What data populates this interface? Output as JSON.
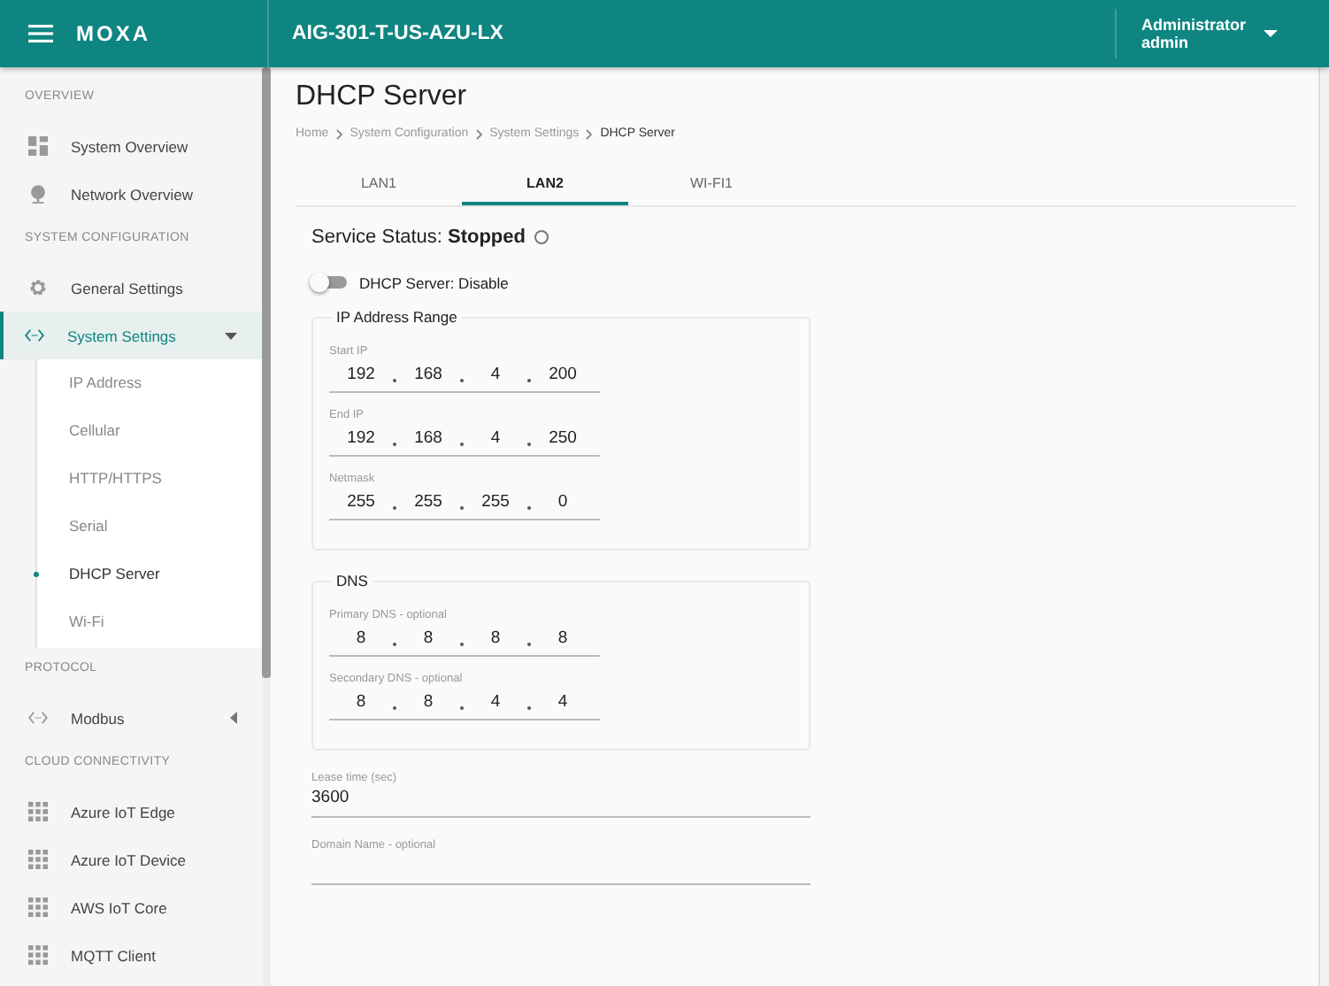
{
  "header": {
    "brand": "MOXA",
    "device": "AIG-301-T-US-AZU-LX",
    "user": {
      "role": "Administrator",
      "name": "admin"
    }
  },
  "sidebar": {
    "sections": [
      {
        "title": "OVERVIEW",
        "items": [
          {
            "label": "System Overview",
            "kind": "dashboard",
            "selected": false
          },
          {
            "label": "Network Overview",
            "kind": "globe",
            "selected": false
          }
        ]
      },
      {
        "title": "SYSTEM CONFIGURATION",
        "items": [
          {
            "label": "General Settings",
            "kind": "gear",
            "selected": false
          },
          {
            "label": "System Settings",
            "kind": "code",
            "selected": true,
            "expanded": true,
            "children": [
              {
                "label": "IP Address",
                "selected": false
              },
              {
                "label": "Cellular",
                "selected": false
              },
              {
                "label": "HTTP/HTTPS",
                "selected": false
              },
              {
                "label": "Serial",
                "selected": false
              },
              {
                "label": "DHCP Server",
                "selected": true
              },
              {
                "label": "Wi-Fi",
                "selected": false
              }
            ]
          }
        ]
      },
      {
        "title": "PROTOCOL",
        "items": [
          {
            "label": "Modbus",
            "kind": "code",
            "selected": false,
            "expanded": false
          }
        ]
      },
      {
        "title": "CLOUD CONNECTIVITY",
        "items": [
          {
            "label": "Azure IoT Edge",
            "kind": "apps",
            "selected": false
          },
          {
            "label": "Azure IoT Device",
            "kind": "apps",
            "selected": false
          },
          {
            "label": "AWS IoT Core",
            "kind": "apps",
            "selected": false
          },
          {
            "label": "MQTT Client",
            "kind": "apps",
            "selected": false
          }
        ]
      }
    ]
  },
  "page": {
    "title": "DHCP Server",
    "breadcrumb": [
      "Home",
      "System Configuration",
      "System Settings",
      "DHCP Server"
    ],
    "tabs": [
      {
        "label": "LAN1",
        "selected": false
      },
      {
        "label": "LAN2",
        "selected": true
      },
      {
        "label": "WI-FI1",
        "selected": false
      }
    ],
    "service_status": {
      "label": "Service Status:",
      "value": "Stopped",
      "running": false
    },
    "dhcp_toggle": {
      "label": "DHCP Server: Disable",
      "on": false
    },
    "groups": [
      {
        "title": "IP Address Range",
        "fields": [
          {
            "label": "Start IP",
            "octets": [
              "192",
              "168",
              "4",
              "200"
            ]
          },
          {
            "label": "End IP",
            "octets": [
              "192",
              "168",
              "4",
              "250"
            ]
          },
          {
            "label": "Netmask",
            "octets": [
              "255",
              "255",
              "255",
              "0"
            ]
          }
        ]
      },
      {
        "title": "DNS",
        "fields": [
          {
            "label": "Primary DNS - optional",
            "octets": [
              "8",
              "8",
              "8",
              "8"
            ]
          },
          {
            "label": "Secondary DNS - optional",
            "octets": [
              "8",
              "8",
              "4",
              "4"
            ]
          }
        ]
      }
    ],
    "lease_time": {
      "label": "Lease time (sec)",
      "value": "3600"
    },
    "domain_name": {
      "label": "Domain Name - optional"
    }
  }
}
